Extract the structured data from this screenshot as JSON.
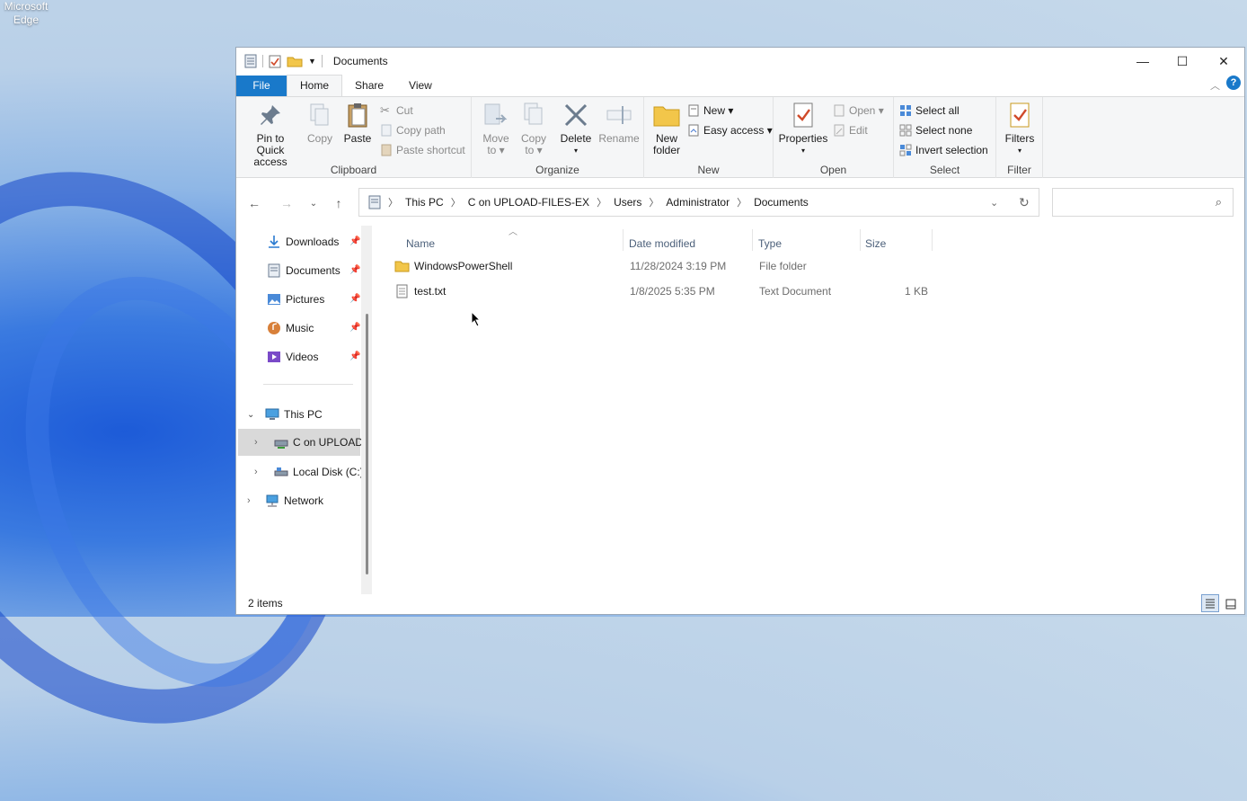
{
  "desktop": {
    "edge_label_1": "Microsoft",
    "edge_label_2": "Edge"
  },
  "window": {
    "title": "Documents",
    "minimize": "—",
    "maximize": "☐",
    "close": "✕"
  },
  "tabs": [
    "File",
    "Home",
    "Share",
    "View"
  ],
  "ribbon": {
    "clipboard": {
      "pin_label_1": "Pin to Quick",
      "pin_label_2": "access",
      "copy": "Copy",
      "paste": "Paste",
      "cut": "Cut",
      "copy_path": "Copy path",
      "paste_shortcut": "Paste shortcut",
      "group": "Clipboard"
    },
    "organize": {
      "move_1": "Move",
      "move_2": "to ▾",
      "copy_1": "Copy",
      "copy_2": "to ▾",
      "delete_1": "Delete",
      "delete_2": "▾",
      "rename": "Rename",
      "group": "Organize"
    },
    "new": {
      "new_folder_1": "New",
      "new_folder_2": "folder",
      "new_item": "New ▾",
      "easy_access": "Easy access ▾",
      "group": "New"
    },
    "open": {
      "properties_1": "Properties",
      "properties_2": "▾",
      "open": "Open ▾",
      "edit": "Edit",
      "group": "Open"
    },
    "select": {
      "select_all": "Select all",
      "select_none": "Select none",
      "invert": "Invert selection",
      "group": "Select"
    },
    "filter": {
      "filters_1": "Filters",
      "filters_2": "▾",
      "group": "Filter"
    }
  },
  "address": {
    "crumbs": [
      "This PC",
      "C on UPLOAD-FILES-EX",
      "Users",
      "Administrator",
      "Documents"
    ]
  },
  "navpane": {
    "quick": [
      {
        "label": "Downloads",
        "icon": "download-icon"
      },
      {
        "label": "Documents",
        "icon": "documents-icon"
      },
      {
        "label": "Pictures",
        "icon": "pictures-icon"
      },
      {
        "label": "Music",
        "icon": "music-icon"
      },
      {
        "label": "Videos",
        "icon": "videos-icon"
      }
    ],
    "this_pc": "This PC",
    "drive_net": "C on UPLOAD-",
    "drive_local": "Local Disk (C:)",
    "network": "Network"
  },
  "columns": {
    "name": "Name",
    "date": "Date modified",
    "type": "Type",
    "size": "Size"
  },
  "files": [
    {
      "name": "WindowsPowerShell",
      "date": "11/28/2024 3:19 PM",
      "type": "File folder",
      "size": "",
      "icon": "folder-icon"
    },
    {
      "name": "test.txt",
      "date": "1/8/2025 5:35 PM",
      "type": "Text Document",
      "size": "1 KB",
      "icon": "text-file-icon"
    }
  ],
  "status": {
    "count": "2 items"
  },
  "colors": {
    "file_tab": "#1979ca",
    "accent": "#1979ca",
    "folder": "#f2c64a"
  }
}
